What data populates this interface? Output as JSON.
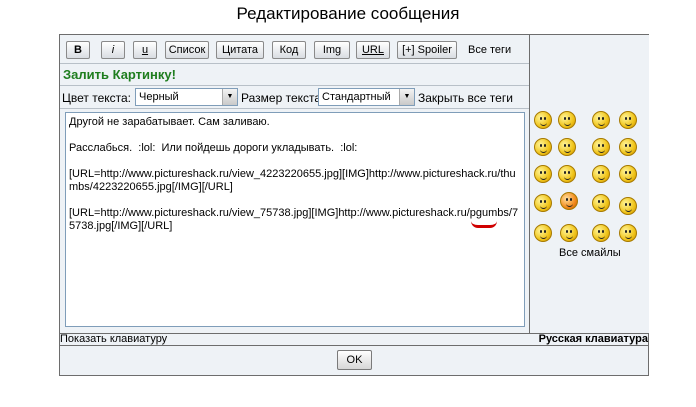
{
  "page_title": "Редактирование сообщения",
  "toolbar": {
    "bold": "B",
    "italic": "i",
    "underline": "u",
    "list": "Список",
    "quote": "Цитата",
    "code": "Код",
    "img": "Img",
    "url": "URL",
    "spoiler": "[+] Spoiler",
    "all_tags": "Все теги"
  },
  "upload_link": "Залить Картинку!",
  "color_row": {
    "color_label": "Цвет текста:",
    "color_value": "Черный",
    "size_label": "Размер текста:",
    "size_value": "Стандартный",
    "close_tags": "Закрыть все теги"
  },
  "message_text": "Другой не зарабатывает. Сам заливаю.\n\nРасслабься.  :lol:  Или пойдешь дороги укладывать.  :lol:\n\n[URL=http://www.pictureshack.ru/view_4223220655.jpg][IMG]http://www.pictureshack.ru/thumbs/4223220655.jpg[/IMG][/URL]\n\n[URL=http://www.pictureshack.ru/view_75738.jpg][IMG]http://www.pictureshack.ru/pgumbs/75738.jpg[/IMG][/URL]",
  "smilies_link": "Все смайлы",
  "show_keyboard": "Показать клавиатуру",
  "russian_keyboard": "Русская клавиатура",
  "ok_button": "OK"
}
